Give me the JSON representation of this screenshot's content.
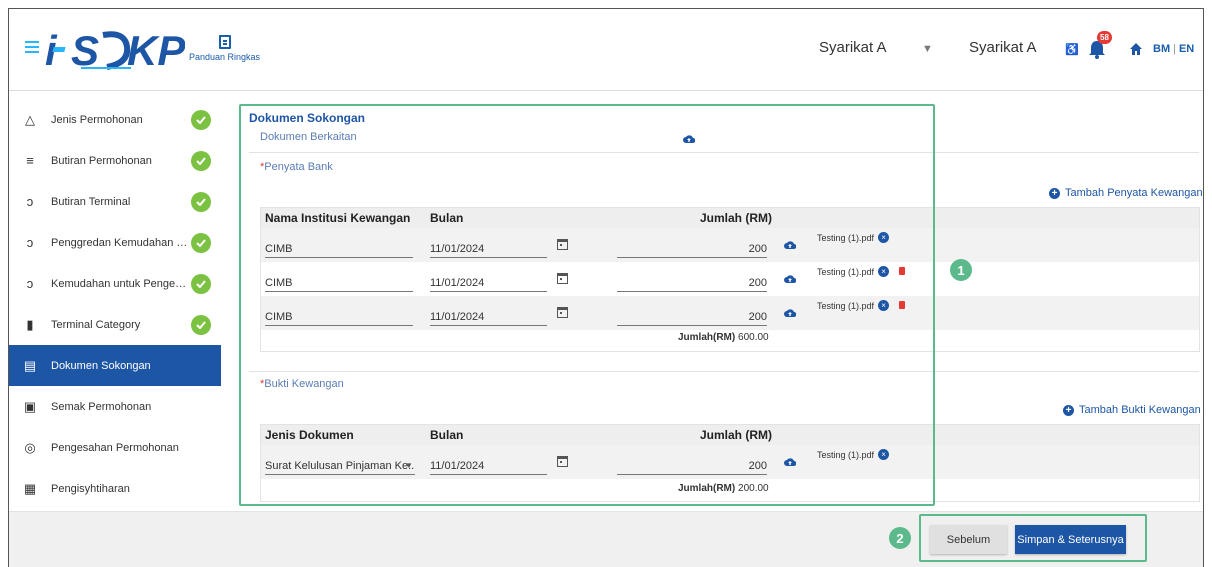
{
  "header": {
    "logo_text": "i-SKP",
    "quick_guide_label": "Panduan Ringkas",
    "company_select": "Syarikat A",
    "company_name": "Syarikat A",
    "accessibility_label": "♿",
    "notification_count": "58",
    "lang_bm": "BM",
    "lang_en": "EN",
    "lang_sep": "|"
  },
  "sidebar": {
    "items": [
      {
        "label": "Jenis Permohonan",
        "icon": "triangle-icon",
        "done": true
      },
      {
        "label": "Butiran Permohonan",
        "icon": "filter-icon",
        "done": true
      },
      {
        "label": "Butiran Terminal",
        "icon": "progress-add-icon",
        "done": true
      },
      {
        "label": "Penggredan Kemudahan Pengendalian",
        "icon": "progress-add-icon",
        "done": true
      },
      {
        "label": "Kemudahan untuk Pengendalian",
        "icon": "progress-add-icon",
        "done": true
      },
      {
        "label": "Terminal Category",
        "icon": "file-icon",
        "done": true
      },
      {
        "label": "Dokumen Sokongan",
        "icon": "document-list-icon",
        "done": false
      },
      {
        "label": "Semak Permohonan",
        "icon": "comment-add-icon",
        "done": false
      },
      {
        "label": "Pengesahan Permohonan",
        "icon": "check-circle-icon",
        "done": false
      },
      {
        "label": "Pengisyhtiharan",
        "icon": "clipboard-icon",
        "done": false
      }
    ]
  },
  "main": {
    "section_title": "Dokumen Sokongan",
    "related_docs_label": "Dokumen Berkaitan",
    "bank": {
      "label": "Penyata Bank",
      "add_label": "Tambah Penyata Kewangan",
      "headers": {
        "institution": "Nama Institusi Kewangan",
        "month": "Bulan",
        "amount": "Jumlah (RM)"
      },
      "rows": [
        {
          "institution": "CIMB",
          "month": "11/01/2024",
          "amount": "200",
          "file": "Testing (1).pdf",
          "deletable": false
        },
        {
          "institution": "CIMB",
          "month": "11/01/2024",
          "amount": "200",
          "file": "Testing (1).pdf",
          "deletable": true
        },
        {
          "institution": "CIMB",
          "month": "11/01/2024",
          "amount": "200",
          "file": "Testing (1).pdf",
          "deletable": true
        }
      ],
      "total_label": "Jumlah(RM)",
      "total_value": "600.00"
    },
    "proof": {
      "label": "Bukti Kewangan",
      "add_label": "Tambah Bukti Kewangan",
      "headers": {
        "doc_type": "Jenis Dokumen",
        "month": "Bulan",
        "amount": "Jumlah (RM)"
      },
      "rows": [
        {
          "doc_type": "Surat Kelulusan Pinjaman Ke...",
          "month": "11/01/2024",
          "amount": "200",
          "file": "Testing (1).pdf"
        }
      ],
      "total_label": "Jumlah(RM)",
      "total_value": "200.00"
    }
  },
  "annotations": {
    "one": "1",
    "two": "2"
  },
  "footer": {
    "prev_label": "Sebelum",
    "next_label": "Simpan & Seterusnya"
  },
  "colors": {
    "primary": "#1e56a6",
    "success": "#7cc242",
    "highlight": "#5cb98b",
    "danger": "#e53935"
  }
}
